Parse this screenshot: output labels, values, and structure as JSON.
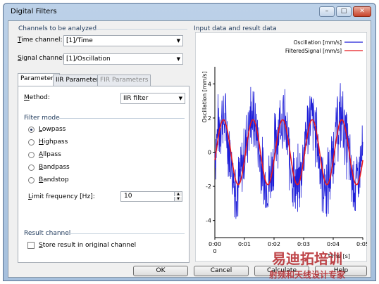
{
  "window": {
    "title": "Digital Filters",
    "minimize_glyph": "–",
    "maximize_glyph": "□",
    "close_glyph": "✕"
  },
  "channels": {
    "group_label": "Channels to be analyzed",
    "time_channel": {
      "label_underlined": "T",
      "label_rest": "ime channel:",
      "value": "[1]/Time"
    },
    "signal_channel": {
      "label_underlined": "S",
      "label_rest": "ignal channel:",
      "value": "[1]/Oscillation"
    }
  },
  "tabs": [
    {
      "label": "Parameters",
      "active": true
    },
    {
      "label": "IIR Parameters",
      "active": false
    },
    {
      "label": "FIR Parameters",
      "active": false
    }
  ],
  "parameters": {
    "method": {
      "label_underlined": "M",
      "label_rest": "ethod:",
      "value": "IIR filter"
    },
    "filter_mode": {
      "label": "Filter mode",
      "options": [
        {
          "u": "L",
          "rest": "owpass",
          "checked": true
        },
        {
          "u": "H",
          "rest": "ighpass",
          "checked": false
        },
        {
          "u": "A",
          "rest": "llpass",
          "checked": false
        },
        {
          "u": "B",
          "rest": "andpass",
          "checked": false
        },
        {
          "u": "B",
          "rest": "andstop",
          "checked": false
        }
      ]
    },
    "limit_frequency": {
      "label_underlined": "L",
      "label_rest": "imit frequency [Hz]:",
      "value": "10"
    },
    "result_channel": {
      "label": "Result channel",
      "store_label_underlined": "S",
      "store_label_rest": "tore result in original channel",
      "checked": false
    }
  },
  "buttons": {
    "ok": "OK",
    "cancel": "Cancel",
    "calculate": "Calculate",
    "help": "Help"
  },
  "chart_group_label": "Input data and result data",
  "chart_data": {
    "type": "line",
    "ylabel": "Oscillation [mm/s]",
    "xlabel": "Time [s]",
    "x_start_label": "0",
    "xlim": [
      0,
      0.05
    ],
    "ylim": [
      -5,
      5
    ],
    "x_ticks": [
      "0:00",
      "0:01",
      "0:02",
      "0:03",
      "0:04",
      "0:05"
    ],
    "y_ticks": [
      "4",
      "2",
      "0",
      "-2",
      "-4"
    ],
    "legend_position": "top-right",
    "series": [
      {
        "name": "Oscillation [mm/s]",
        "color": "#1f1fd8",
        "signal_frequency_hz": 100,
        "amplitude": 2,
        "noise_amplitude": 2.5
      },
      {
        "name": "FilteredSignal [mm/s]",
        "color": "#e8191f",
        "signal_frequency_hz": 100,
        "amplitude": 1.9
      }
    ]
  },
  "watermark": {
    "line1": "易迪拓培训",
    "line2": "射频和天线设计专家",
    "color": "#b5252a"
  }
}
